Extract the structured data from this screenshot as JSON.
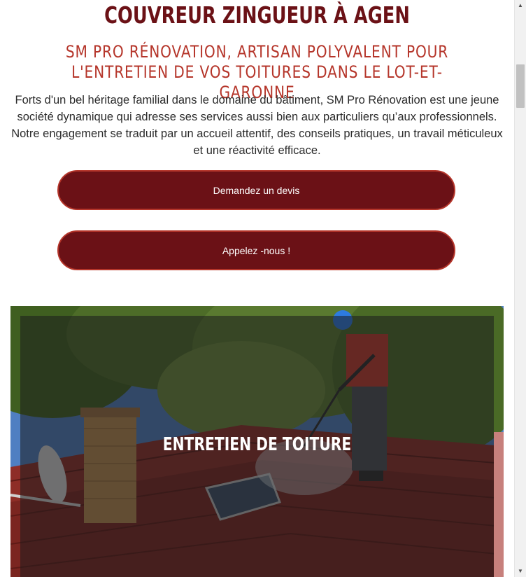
{
  "header": {
    "title": "COUVREUR ZINGUEUR À AGEN",
    "subtitle": "SM PRO RÉNOVATION, ARTISAN POLYVALENT POUR L'ENTRETIEN DE VOS TOITURES DANS LE LOT-ET-GARONNE"
  },
  "intro": {
    "text": "Forts d'un bel héritage familial dans le domaine du bâtiment, SM Pro Rénovation est une jeune société dynamique qui adresse ses services aussi bien aux particuliers qu’aux professionnels. Notre engagement se traduit par un accueil attentif, des conseils pratiques, un travail méticuleux et une réactivité efficace."
  },
  "buttons": {
    "quote_label": "Demandez un devis",
    "call_label": "Appelez -nous !"
  },
  "hero": {
    "caption": "ENTRETIEN DE TOITURE"
  },
  "colors": {
    "primary": "#6b1116",
    "accent": "#b5352a",
    "text": "#2b2b2b"
  },
  "scrollbar": {
    "up_icon": "scroll-up-arrow-icon",
    "down_icon": "scroll-down-arrow-icon"
  }
}
